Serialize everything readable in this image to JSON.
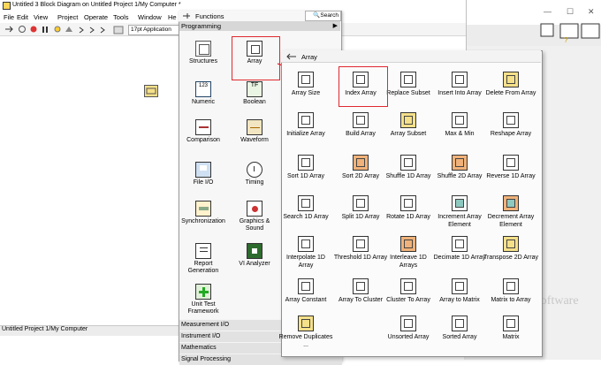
{
  "window": {
    "title": "Untitled 3 Block Diagram on Untitled Project 1/My Computer *",
    "status": "Untitled Project 1/My Computer"
  },
  "menu": [
    "File",
    "Edit",
    "View",
    "Project",
    "Operate",
    "Tools",
    "Window",
    "He"
  ],
  "toolbar": {
    "font": "17pt Application"
  },
  "functions_palette": {
    "title": "Functions",
    "search": "Search",
    "category": "Programming",
    "items": [
      "Structures",
      "Array",
      "Numeric",
      "Boolean",
      "Comparison",
      "Waveform",
      "File I/O",
      "Timing",
      "Synchronization",
      "Graphics & Sound",
      "Report Generation",
      "VI Analyzer",
      "Unit Test Framework"
    ],
    "bottom_categories": [
      "Measurement I/O",
      "Instrument I/O",
      "Mathematics",
      "Signal Processing"
    ]
  },
  "array_palette": {
    "title": "Array",
    "items": [
      "Array Size",
      "Index Array",
      "Replace Subset",
      "Insert Into Array",
      "Delete From Array",
      "Initialize Array",
      "Build Array",
      "Array Subset",
      "Max & Min",
      "Reshape Array",
      "Sort 1D Array",
      "Sort 2D Array",
      "Shuffle 1D Array",
      "Shuffle 2D Array",
      "Reverse 1D Array",
      "Search 1D Array",
      "Split 1D Array",
      "Rotate 1D Array",
      "Increment Array Element",
      "Decrement Array Element",
      "Interpolate 1D Array",
      "Threshold 1D Array",
      "Interleave 1D Arrays",
      "Decimate 1D Array",
      "Transpose 2D Array",
      "Array Constant",
      "Array To Cluster",
      "Cluster To Array",
      "Array to Matrix",
      "Matrix to Array",
      "Remove Duplicates ...",
      "",
      "Unsorted Array",
      "Sorted Array",
      "Matrix"
    ]
  },
  "watermark": "Software",
  "colors": {
    "highlight": "#e0282f",
    "orange_icon": "#f0b27a",
    "yellow_icon": "#f5e08a"
  }
}
